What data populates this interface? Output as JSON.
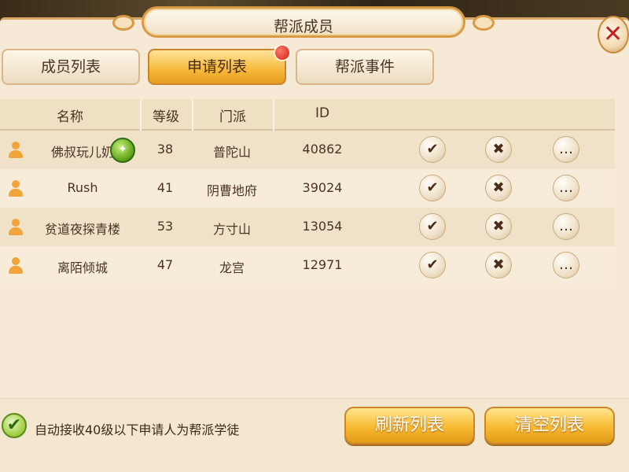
{
  "title": "帮派成员",
  "tabs": [
    {
      "label": "成员列表",
      "active": false
    },
    {
      "label": "申请列表",
      "active": true,
      "has_notification": true
    },
    {
      "label": "帮派事件",
      "active": false
    }
  ],
  "table": {
    "columns": [
      "名称",
      "等级",
      "门派",
      "ID"
    ],
    "rows": [
      {
        "name": "佛叔玩儿奶",
        "level": "38",
        "school": "普陀山",
        "id": "40862",
        "vip_badge": true
      },
      {
        "name": "Rush",
        "level": "41",
        "school": "阴曹地府",
        "id": "39024",
        "vip_badge": false
      },
      {
        "name": "贫道夜探青楼",
        "level": "53",
        "school": "方寸山",
        "id": "13054",
        "vip_badge": false
      },
      {
        "name": "离陌倾城",
        "level": "47",
        "school": "龙宫",
        "id": "12971",
        "vip_badge": false
      }
    ]
  },
  "footer": {
    "auto_accept_label": "自动接收40级以下申请人为帮派学徒",
    "auto_accept_checked": true,
    "refresh_label": "刷新列表",
    "clear_label": "清空列表"
  },
  "icons": {
    "close": "close-icon",
    "accept": "checkmark-icon",
    "reject": "x-icon",
    "chat": "chat-bubble-icon",
    "person": "person-icon",
    "vip": "vip-badge-icon",
    "notification": "notification-dot-icon"
  },
  "colors": {
    "accent": "#f5b83a",
    "panel": "#f6ead6",
    "close": "#c71f1f",
    "person": "#f0a43a",
    "checkbox": "#9ccc3a"
  }
}
